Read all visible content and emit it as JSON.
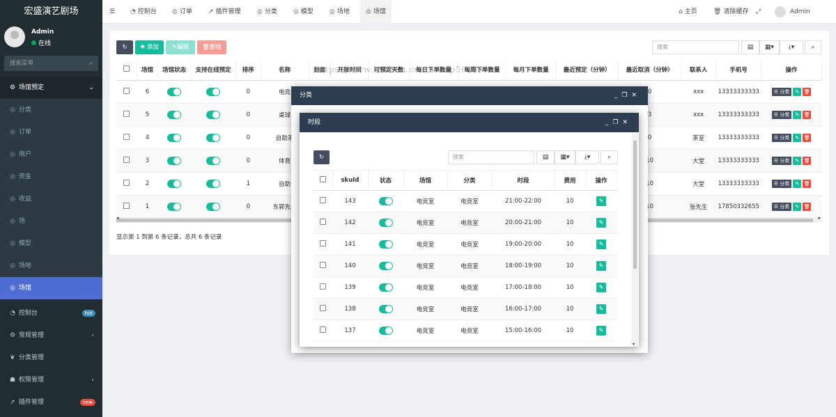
{
  "app": {
    "title": "宏盛演艺剧场"
  },
  "user": {
    "name": "Admin",
    "status": "在线"
  },
  "sidebar": {
    "search_placeholder": "搜索菜单",
    "items": [
      {
        "label": "场馆预定",
        "icon": "gear-icon"
      },
      {
        "label": "分类",
        "icon": "circle-icon"
      },
      {
        "label": "订单",
        "icon": "circle-icon"
      },
      {
        "label": "用户",
        "icon": "circle-icon"
      },
      {
        "label": "资金",
        "icon": "circle-icon"
      },
      {
        "label": "收益",
        "icon": "circle-icon"
      },
      {
        "label": "场",
        "icon": "circle-icon"
      },
      {
        "label": "模型",
        "icon": "circle-icon"
      },
      {
        "label": "场地",
        "icon": "circle-icon"
      },
      {
        "label": "场馆",
        "icon": "circle-icon"
      },
      {
        "label": "控制台",
        "icon": "dashboard-icon",
        "badge": "hot"
      },
      {
        "label": "常规管理",
        "icon": "gears-icon"
      },
      {
        "label": "分类管理",
        "icon": "leaf-icon"
      },
      {
        "label": "权限管理",
        "icon": "group-icon"
      },
      {
        "label": "插件管理",
        "icon": "rocket-icon",
        "badge": "new"
      }
    ]
  },
  "topbar": {
    "tabs": [
      "控制台",
      "订单",
      "插件管理",
      "分类",
      "模型",
      "场地",
      "场馆"
    ],
    "home": "主页",
    "clear_cache": "清除缓存",
    "user": "Admin"
  },
  "toolbar": {
    "add": "添加",
    "edit": "编辑",
    "delete": "删除",
    "search_placeholder": "搜索"
  },
  "main_table": {
    "headers": [
      "场馆",
      "场馆状态",
      "支持在线预定",
      "排序",
      "名称",
      "封面",
      "开放时间",
      "可预定天数",
      "每日下单数量",
      "每周下单数量",
      "每月下单数量",
      "最近预定（分钟）",
      "最近取消（分钟）",
      "联系人",
      "手机号",
      "操作"
    ],
    "rows": [
      {
        "id": "6",
        "sort": "0",
        "name": "电竞",
        "cancel": "0",
        "contact": "xxx",
        "phone": "13333333333"
      },
      {
        "id": "5",
        "sort": "0",
        "name": "桌球",
        "cancel": "3",
        "contact": "xxx",
        "phone": "13333333333"
      },
      {
        "id": "4",
        "sort": "0",
        "name": "自助茶",
        "cancel": "0",
        "contact": "茶室",
        "phone": "13333333333"
      },
      {
        "id": "3",
        "sort": "0",
        "name": "体育",
        "cancel": "10",
        "contact": "大堂",
        "phone": "13333333333"
      },
      {
        "id": "2",
        "sort": "1",
        "name": "自助",
        "cancel": "10",
        "contact": "大堂",
        "phone": "13333333333"
      },
      {
        "id": "1",
        "sort": "0",
        "name": "东郭先生",
        "cancel": "10",
        "contact": "张先生",
        "phone": "17850332655"
      }
    ],
    "action_label": "分类",
    "footer": "显示第 1 到第 6 条记录，总共 6 条记录"
  },
  "watermark": "https://www.huzhan.com/ishop50036",
  "dialog_category": {
    "title": "分类"
  },
  "dialog_timeslot": {
    "title": "时段",
    "search_placeholder": "搜索",
    "headers": [
      "skuId",
      "状态",
      "场馆",
      "分类",
      "时段",
      "费用",
      "操作"
    ],
    "rows": [
      {
        "sku": "143",
        "venue": "电竞室",
        "cat": "电竞室",
        "slot": "21:00-22:00",
        "fee": "10"
      },
      {
        "sku": "142",
        "venue": "电竞室",
        "cat": "电竞室",
        "slot": "20:00-21:00",
        "fee": "10"
      },
      {
        "sku": "141",
        "venue": "电竞室",
        "cat": "电竞室",
        "slot": "19:00-20:00",
        "fee": "10"
      },
      {
        "sku": "140",
        "venue": "电竞室",
        "cat": "电竞室",
        "slot": "18:00-19:00",
        "fee": "10"
      },
      {
        "sku": "139",
        "venue": "电竞室",
        "cat": "电竞室",
        "slot": "17:00-18:00",
        "fee": "10"
      },
      {
        "sku": "138",
        "venue": "电竞室",
        "cat": "电竞室",
        "slot": "16:00-17:00",
        "fee": "10"
      },
      {
        "sku": "137",
        "venue": "电竞室",
        "cat": "电竞室",
        "slot": "15:00-16:00",
        "fee": "10"
      }
    ]
  },
  "colors": {
    "sidebar": "#222d32",
    "active": "#4e6dd2",
    "primary": "#18bc9c",
    "danger": "#e74c3c",
    "dialog_head": "#2c3e50"
  }
}
